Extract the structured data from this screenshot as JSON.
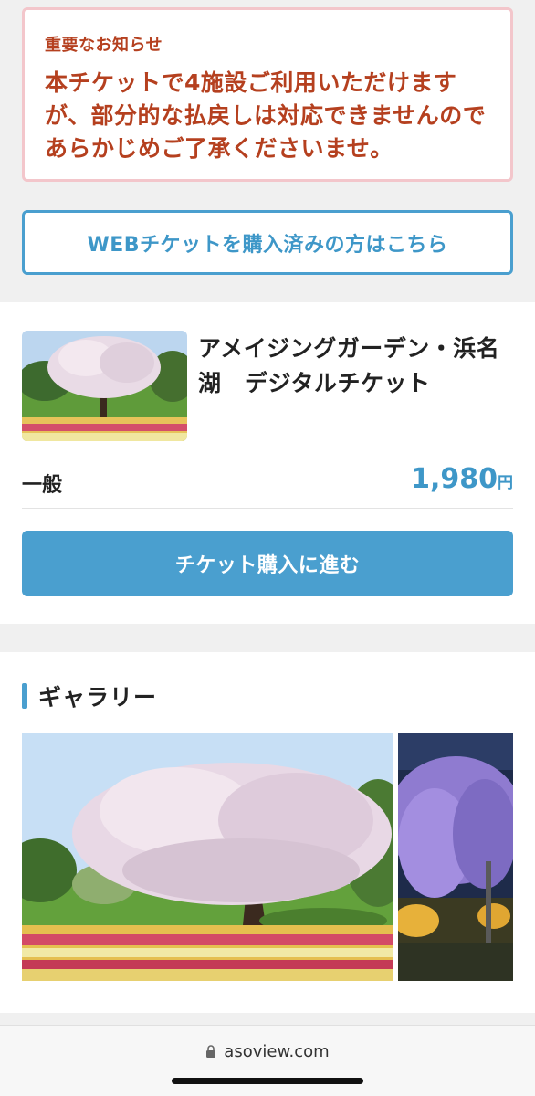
{
  "notice": {
    "title": "重要なお知らせ",
    "body": "本チケットで4施設ご利用いただけますが、部分的な払戻しは対応できませんのであらかじめご了承くださいませ。"
  },
  "purchased_link": {
    "label": "WEBチケットを購入済みの方はこちら"
  },
  "product": {
    "name": "アメイジングガーデン・浜名湖　デジタルチケット",
    "price_type": "一般",
    "price": "1,980",
    "currency": "円",
    "buy_label": "チケット購入に進む"
  },
  "gallery": {
    "title": "ギャラリー"
  },
  "browser": {
    "url": "asoview.com"
  },
  "colors": {
    "accent": "#4a9fcf",
    "notice_text": "#b5401f",
    "notice_border": "#f3c6cb"
  },
  "icons": {
    "lock": "lock-icon"
  }
}
